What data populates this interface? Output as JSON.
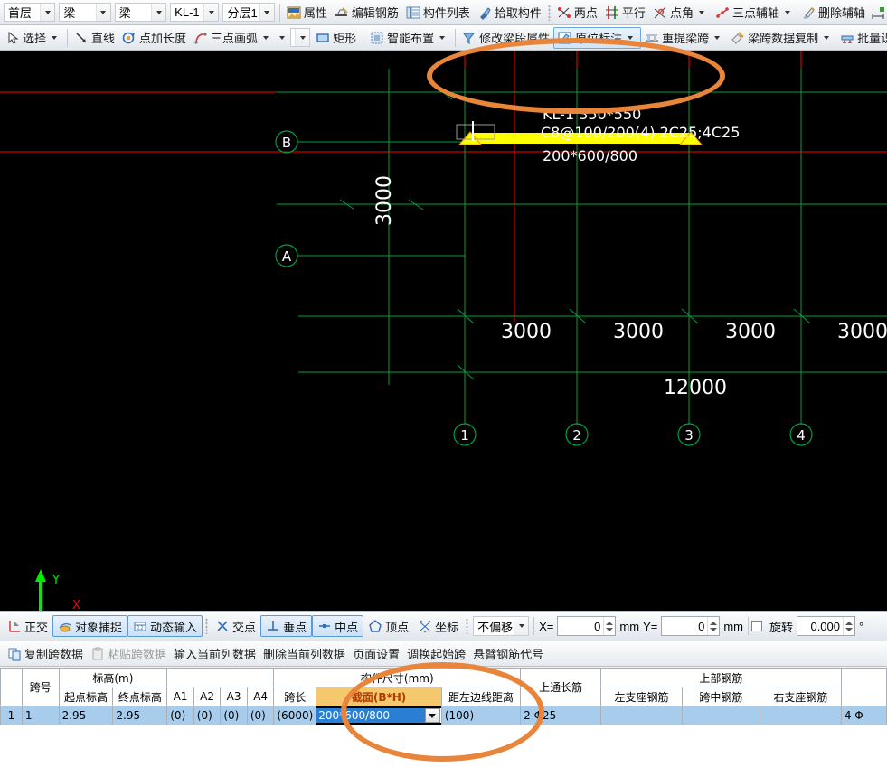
{
  "toolbar1": {
    "combos": [
      {
        "name": "floor-combo",
        "value": "首层"
      },
      {
        "name": "category-combo",
        "value": "梁"
      },
      {
        "name": "type-combo",
        "value": "梁"
      },
      {
        "name": "member-combo",
        "value": "KL-1"
      },
      {
        "name": "layer-combo",
        "value": "分层1"
      }
    ],
    "items": [
      {
        "name": "properties-button",
        "label": "属性",
        "icon": "properties-icon",
        "caret": false
      },
      {
        "name": "edit-rebar-button",
        "label": "编辑钢筋",
        "icon": "edit-rebar-icon",
        "caret": false
      },
      {
        "name": "member-list-button",
        "label": "构件列表",
        "icon": "member-list-icon",
        "caret": false
      },
      {
        "name": "pick-member-button",
        "label": "拾取构件",
        "icon": "pick-member-icon",
        "caret": false
      },
      {
        "name": "two-point-button",
        "label": "两点",
        "icon": "two-point-icon",
        "caret": false
      },
      {
        "name": "parallel-button",
        "label": "平行",
        "icon": "parallel-icon",
        "caret": false
      },
      {
        "name": "point-angle-button",
        "label": "点角",
        "icon": "point-angle-icon",
        "caret": true
      },
      {
        "name": "three-point-axis-button",
        "label": "三点辅轴",
        "icon": "three-point-axis-icon",
        "caret": true
      },
      {
        "name": "delete-axis-button",
        "label": "删除辅轴",
        "icon": "delete-axis-icon",
        "caret": false
      }
    ]
  },
  "toolbar2": {
    "items": [
      {
        "name": "select-button",
        "label": "选择",
        "icon": "cursor-icon",
        "caret": true
      },
      {
        "name": "line-button",
        "label": "直线",
        "icon": "line-icon",
        "caret": false
      },
      {
        "name": "point-length-button",
        "label": "点加长度",
        "icon": "point-length-icon",
        "caret": false
      },
      {
        "name": "three-point-arc-button",
        "label": "三点画弧",
        "icon": "arc-icon",
        "caret": true
      },
      {
        "name": "rectangle-button",
        "label": "矩形",
        "icon": "rectangle-icon",
        "caret": false
      },
      {
        "name": "smart-layout-button",
        "label": "智能布置",
        "icon": "smart-layout-icon",
        "caret": true
      },
      {
        "name": "modify-beam-segment-button",
        "label": "修改梁段属性",
        "icon": "modify-beam-icon",
        "caret": false
      },
      {
        "name": "original-annotation-button",
        "label": "原位标注",
        "icon": "original-annotation-icon",
        "caret": true,
        "active": true
      },
      {
        "name": "re-extract-beam-span-button",
        "label": "重提梁跨",
        "icon": "re-extract-icon",
        "caret": true
      },
      {
        "name": "beam-span-copy-button",
        "label": "梁跨数据复制",
        "icon": "copy-span-icon",
        "caret": true
      },
      {
        "name": "batch-identify-support-button",
        "label": "批量识别梁支座",
        "icon": "batch-identify-icon",
        "caret": false
      }
    ],
    "empty_combo_value": ""
  },
  "canvas": {
    "beam": {
      "name_size": "KL-1 350*550",
      "rebar": "C8@100/200(4) 2C25;4C25",
      "section": "200*600/800"
    },
    "grid_bubbles_vertical": [
      "B",
      "A"
    ],
    "grid_bubbles_horizontal": [
      "1",
      "2",
      "3",
      "4"
    ],
    "dim_vertical": "3000",
    "dim_spans": [
      "3000",
      "3000",
      "3000",
      "3000"
    ],
    "dim_total": "12000",
    "axis_x_label": "X",
    "axis_y_label": "Y",
    "colors": {
      "grid": "#00a040",
      "beam": "#ffff00",
      "axis_red": "#ff0000",
      "text": "#ffffff",
      "background": "#000000"
    }
  },
  "snapbar": {
    "items": [
      {
        "name": "ortho-toggle",
        "label": "正交",
        "icon": "ortho-icon",
        "on": false
      },
      {
        "name": "object-snap-toggle",
        "label": "对象捕捉",
        "icon": "object-snap-icon",
        "on": true
      },
      {
        "name": "dynamic-input-toggle",
        "label": "动态输入",
        "icon": "dynamic-input-icon",
        "on": true
      },
      {
        "name": "intersection-snap-toggle",
        "label": "交点",
        "icon": "intersection-icon",
        "on": false
      },
      {
        "name": "perpendicular-snap-toggle",
        "label": "垂点",
        "icon": "perpendicular-icon",
        "on": true
      },
      {
        "name": "midpoint-snap-toggle",
        "label": "中点",
        "icon": "midpoint-icon",
        "on": true
      },
      {
        "name": "vertex-snap-toggle",
        "label": "顶点",
        "icon": "vertex-icon",
        "on": false
      },
      {
        "name": "coordinate-snap-toggle",
        "label": "坐标",
        "icon": "coordinate-icon",
        "on": false
      }
    ],
    "offset_mode": "不偏移",
    "x_label": "X=",
    "x_value": "0",
    "x_unit": "mm",
    "y_label": "Y=",
    "y_value": "0",
    "y_unit": "mm",
    "rotate_label": "旋转",
    "rotate_value": "0.000",
    "degree_unit": "°"
  },
  "cmdbar": {
    "items": [
      {
        "name": "copy-span-data-button",
        "label": "复制跨数据",
        "icon": "copy-icon",
        "disabled": false
      },
      {
        "name": "paste-span-data-button",
        "label": "粘贴跨数据",
        "icon": "paste-icon",
        "disabled": true
      },
      {
        "name": "input-current-column-button",
        "label": "输入当前列数据",
        "icon": "",
        "disabled": false
      },
      {
        "name": "delete-current-column-button",
        "label": "删除当前列数据",
        "icon": "",
        "disabled": false
      },
      {
        "name": "page-setup-button",
        "label": "页面设置",
        "icon": "",
        "disabled": false
      },
      {
        "name": "swap-start-span-button",
        "label": "调换起始跨",
        "icon": "",
        "disabled": false
      },
      {
        "name": "cantilever-rebar-code-button",
        "label": "悬臂钢筋代号",
        "icon": "",
        "disabled": false
      }
    ]
  },
  "grid": {
    "group_headers": [
      {
        "name": "group-elevation",
        "label": "标高(m)"
      },
      {
        "name": "group-member-size",
        "label": "构件尺寸(mm)"
      },
      {
        "name": "group-top-rebar",
        "label": "上部钢筋"
      }
    ],
    "columns": [
      {
        "name": "col-span-no",
        "label": "跨号"
      },
      {
        "name": "col-start-elev",
        "label": "起点标高"
      },
      {
        "name": "col-end-elev",
        "label": "终点标高"
      },
      {
        "name": "col-a1",
        "label": "A1"
      },
      {
        "name": "col-a2",
        "label": "A2"
      },
      {
        "name": "col-a3",
        "label": "A3"
      },
      {
        "name": "col-a4",
        "label": "A4"
      },
      {
        "name": "col-span-length",
        "label": "跨长"
      },
      {
        "name": "col-section",
        "label": "截面(B*H)",
        "highlight": true
      },
      {
        "name": "col-dist-left",
        "label": "距左边线距离"
      },
      {
        "name": "col-top-through",
        "label": "上通长筋"
      },
      {
        "name": "col-left-support",
        "label": "左支座钢筋"
      },
      {
        "name": "col-mid-span",
        "label": "跨中钢筋"
      },
      {
        "name": "col-right-support",
        "label": "右支座钢筋"
      },
      {
        "name": "col-extra",
        "label": ""
      }
    ],
    "row": {
      "index": "1",
      "span_no": "1",
      "start_elev": "2.95",
      "end_elev": "2.95",
      "a1": "(0)",
      "a2": "(0)",
      "a3": "(0)",
      "a4": "(0)",
      "span_length": "(6000)",
      "section_selected": "200*600/800",
      "dist_left": "(100)",
      "top_through": "2 Φ25",
      "left_support": "",
      "mid_span": "",
      "right_support": "",
      "extra": "4 Φ"
    }
  },
  "annotations": [
    {
      "name": "annotation-ellipse-beam-label"
    },
    {
      "name": "annotation-ellipse-section-cell"
    }
  ]
}
